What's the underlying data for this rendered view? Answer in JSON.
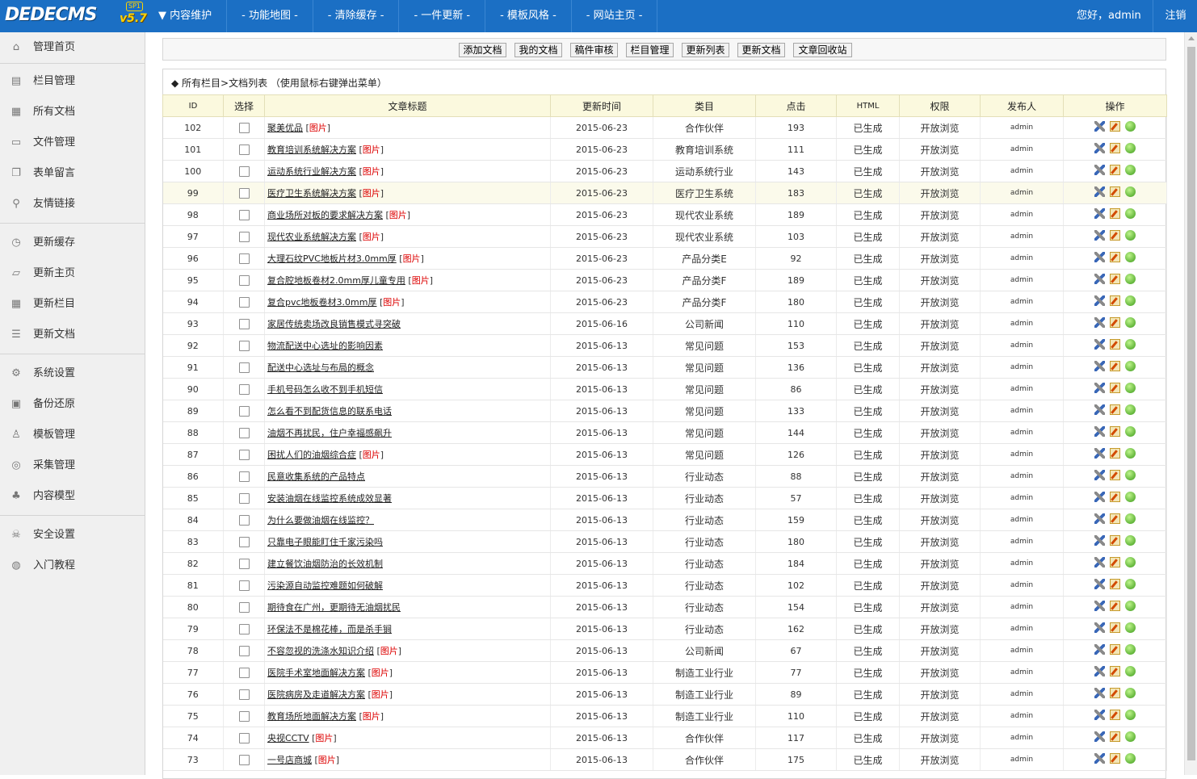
{
  "app": {
    "logo_text": "DEDECMS",
    "logo_version": "v5.7",
    "logo_edition": "SP1",
    "brand_color": "#1b6fc4"
  },
  "topnav": {
    "items": [
      {
        "label": "内容维护",
        "prefix": "▼"
      },
      {
        "label": "功能地图",
        "prefix": "-"
      },
      {
        "label": "清除缓存",
        "prefix": "-"
      },
      {
        "label": "一件更新",
        "prefix": "-"
      },
      {
        "label": "模板风格",
        "prefix": "-"
      },
      {
        "label": "网站主页",
        "prefix": "-"
      }
    ],
    "greeting": "您好，admin",
    "logout": "注销"
  },
  "sidebar": {
    "items": [
      {
        "label": "管理首页",
        "icon": "home-icon",
        "glyph": "⌂"
      },
      {
        "label": "栏目管理",
        "icon": "column-icon",
        "glyph": "▤"
      },
      {
        "label": "所有文档",
        "icon": "document-icon",
        "glyph": "▦"
      },
      {
        "label": "文件管理",
        "icon": "monitor-icon",
        "glyph": "▭"
      },
      {
        "label": "表单留言",
        "icon": "form-icon",
        "glyph": "❐"
      },
      {
        "label": "友情链接",
        "icon": "link-icon",
        "glyph": "⚲"
      },
      {
        "label": "更新缓存",
        "icon": "clock-icon",
        "glyph": "◷"
      },
      {
        "label": "更新主页",
        "icon": "folder-icon",
        "glyph": "▱"
      },
      {
        "label": "更新栏目",
        "icon": "calendar-icon",
        "glyph": "▦"
      },
      {
        "label": "更新文档",
        "icon": "list-icon",
        "glyph": "☰"
      },
      {
        "label": "系统设置",
        "icon": "gear-icon",
        "glyph": "⚙"
      },
      {
        "label": "备份还原",
        "icon": "backup-icon",
        "glyph": "▣"
      },
      {
        "label": "模板管理",
        "icon": "user-icon",
        "glyph": "♙"
      },
      {
        "label": "采集管理",
        "icon": "collect-icon",
        "glyph": "◎"
      },
      {
        "label": "内容模型",
        "icon": "sitemap-icon",
        "glyph": "♣"
      },
      {
        "label": "安全设置",
        "icon": "skull-icon",
        "glyph": "☠"
      },
      {
        "label": "入门教程",
        "icon": "help-icon",
        "glyph": "◍"
      }
    ]
  },
  "toolbar": {
    "buttons": [
      "添加文档",
      "我的文档",
      "稿件审核",
      "栏目管理",
      "更新列表",
      "更新文档",
      "文章回收站"
    ]
  },
  "list": {
    "breadcrumb": "◆  所有栏目>文档列表  （使用鼠标右键弹出菜单）",
    "columns": [
      "ID",
      "选择",
      "文章标题",
      "更新时间",
      "类目",
      "点击",
      "HTML",
      "权限",
      "发布人",
      "操作"
    ],
    "pic_label": "图片",
    "rows": [
      {
        "id": "102",
        "title": "聚美优品",
        "pic": true,
        "date": "2015-06-23",
        "category": "合作伙伴",
        "clicks": "193",
        "html": "已生成",
        "perm": "开放浏览",
        "author": "admin"
      },
      {
        "id": "101",
        "title": "教育培训系统解决方案",
        "pic": true,
        "date": "2015-06-23",
        "category": "教育培训系统",
        "clicks": "111",
        "html": "已生成",
        "perm": "开放浏览",
        "author": "admin"
      },
      {
        "id": "100",
        "title": "运动系统行业解决方案",
        "pic": true,
        "date": "2015-06-23",
        "category": "运动系统行业",
        "clicks": "143",
        "html": "已生成",
        "perm": "开放浏览",
        "author": "admin"
      },
      {
        "id": "99",
        "title": "医疗卫生系统解决方案",
        "pic": true,
        "date": "2015-06-23",
        "category": "医疗卫生系统",
        "clicks": "183",
        "html": "已生成",
        "perm": "开放浏览",
        "author": "admin"
      },
      {
        "id": "98",
        "title": "商业场所对板的要求解决方案",
        "pic": true,
        "date": "2015-06-23",
        "category": "现代农业系统",
        "clicks": "189",
        "html": "已生成",
        "perm": "开放浏览",
        "author": "admin"
      },
      {
        "id": "97",
        "title": "现代农业系统解决方案",
        "pic": true,
        "date": "2015-06-23",
        "category": "现代农业系统",
        "clicks": "103",
        "html": "已生成",
        "perm": "开放浏览",
        "author": "admin"
      },
      {
        "id": "96",
        "title": "大理石纹PVC地板片材3.0mm厚",
        "pic": true,
        "date": "2015-06-23",
        "category": "产品分类E",
        "clicks": "92",
        "html": "已生成",
        "perm": "开放浏览",
        "author": "admin"
      },
      {
        "id": "95",
        "title": "复合腔地板卷材2.0mm厚儿童专用",
        "pic": true,
        "date": "2015-06-23",
        "category": "产品分类F",
        "clicks": "189",
        "html": "已生成",
        "perm": "开放浏览",
        "author": "admin"
      },
      {
        "id": "94",
        "title": "复合pvc地板卷材3.0mm厚",
        "pic": true,
        "date": "2015-06-23",
        "category": "产品分类F",
        "clicks": "180",
        "html": "已生成",
        "perm": "开放浏览",
        "author": "admin"
      },
      {
        "id": "93",
        "title": "家居传统卖场改良销售模式寻突破",
        "pic": false,
        "date": "2015-06-16",
        "category": "公司新闻",
        "clicks": "110",
        "html": "已生成",
        "perm": "开放浏览",
        "author": "admin"
      },
      {
        "id": "92",
        "title": "物流配送中心选址的影响因素",
        "pic": false,
        "date": "2015-06-13",
        "category": "常见问题",
        "clicks": "153",
        "html": "已生成",
        "perm": "开放浏览",
        "author": "admin"
      },
      {
        "id": "91",
        "title": "配送中心选址与布局的概念",
        "pic": false,
        "date": "2015-06-13",
        "category": "常见问题",
        "clicks": "136",
        "html": "已生成",
        "perm": "开放浏览",
        "author": "admin"
      },
      {
        "id": "90",
        "title": "手机号码怎么收不到手机短信",
        "pic": false,
        "date": "2015-06-13",
        "category": "常见问题",
        "clicks": "86",
        "html": "已生成",
        "perm": "开放浏览",
        "author": "admin"
      },
      {
        "id": "89",
        "title": "怎么看不到配货信息的联系电话",
        "pic": false,
        "date": "2015-06-13",
        "category": "常见问题",
        "clicks": "133",
        "html": "已生成",
        "perm": "开放浏览",
        "author": "admin"
      },
      {
        "id": "88",
        "title": "油烟不再扰民，住户幸福感飙升",
        "pic": false,
        "date": "2015-06-13",
        "category": "常见问题",
        "clicks": "144",
        "html": "已生成",
        "perm": "开放浏览",
        "author": "admin"
      },
      {
        "id": "87",
        "title": "困扰人们的油烟综合症",
        "pic": true,
        "date": "2015-06-13",
        "category": "常见问题",
        "clicks": "126",
        "html": "已生成",
        "perm": "开放浏览",
        "author": "admin"
      },
      {
        "id": "86",
        "title": "民意收集系统的产品特点",
        "pic": false,
        "date": "2015-06-13",
        "category": "行业动态",
        "clicks": "88",
        "html": "已生成",
        "perm": "开放浏览",
        "author": "admin"
      },
      {
        "id": "85",
        "title": "安装油烟在线监控系统成效显著",
        "pic": false,
        "date": "2015-06-13",
        "category": "行业动态",
        "clicks": "57",
        "html": "已生成",
        "perm": "开放浏览",
        "author": "admin"
      },
      {
        "id": "84",
        "title": "为什么要做油烟在线监控？",
        "pic": false,
        "date": "2015-06-13",
        "category": "行业动态",
        "clicks": "159",
        "html": "已生成",
        "perm": "开放浏览",
        "author": "admin"
      },
      {
        "id": "83",
        "title": "只靠电子眼能盯住千家污染吗",
        "pic": false,
        "date": "2015-06-13",
        "category": "行业动态",
        "clicks": "180",
        "html": "已生成",
        "perm": "开放浏览",
        "author": "admin"
      },
      {
        "id": "82",
        "title": "建立餐饮油烟防治的长效机制",
        "pic": false,
        "date": "2015-06-13",
        "category": "行业动态",
        "clicks": "184",
        "html": "已生成",
        "perm": "开放浏览",
        "author": "admin"
      },
      {
        "id": "81",
        "title": "污染源自动监控难题如何破解",
        "pic": false,
        "date": "2015-06-13",
        "category": "行业动态",
        "clicks": "102",
        "html": "已生成",
        "perm": "开放浏览",
        "author": "admin"
      },
      {
        "id": "80",
        "title": "期待食在广州，更期待无油烟扰民",
        "pic": false,
        "date": "2015-06-13",
        "category": "行业动态",
        "clicks": "154",
        "html": "已生成",
        "perm": "开放浏览",
        "author": "admin"
      },
      {
        "id": "79",
        "title": "环保法不是棉花棒，而是杀手锏",
        "pic": false,
        "date": "2015-06-13",
        "category": "行业动态",
        "clicks": "162",
        "html": "已生成",
        "perm": "开放浏览",
        "author": "admin"
      },
      {
        "id": "78",
        "title": "不容忽视的洗涤水知识介绍",
        "pic": true,
        "date": "2015-06-13",
        "category": "公司新闻",
        "clicks": "67",
        "html": "已生成",
        "perm": "开放浏览",
        "author": "admin"
      },
      {
        "id": "77",
        "title": "医院手术室地面解决方案",
        "pic": true,
        "date": "2015-06-13",
        "category": "制造工业行业",
        "clicks": "77",
        "html": "已生成",
        "perm": "开放浏览",
        "author": "admin"
      },
      {
        "id": "76",
        "title": "医院病房及走道解决方案",
        "pic": true,
        "date": "2015-06-13",
        "category": "制造工业行业",
        "clicks": "89",
        "html": "已生成",
        "perm": "开放浏览",
        "author": "admin"
      },
      {
        "id": "75",
        "title": "教育场所地面解决方案",
        "pic": true,
        "date": "2015-06-13",
        "category": "制造工业行业",
        "clicks": "110",
        "html": "已生成",
        "perm": "开放浏览",
        "author": "admin"
      },
      {
        "id": "74",
        "title": "央视CCTV",
        "pic": true,
        "date": "2015-06-13",
        "category": "合作伙伴",
        "clicks": "117",
        "html": "已生成",
        "perm": "开放浏览",
        "author": "admin"
      },
      {
        "id": "73",
        "title": "一号店商城",
        "pic": true,
        "date": "2015-06-13",
        "category": "合作伙伴",
        "clicks": "175",
        "html": "已生成",
        "perm": "开放浏览",
        "author": "admin"
      }
    ]
  },
  "colors": {
    "header_row": "#fbf9de",
    "highlight_row": "#fbfaeb",
    "pic_tag": "#dd0000"
  }
}
